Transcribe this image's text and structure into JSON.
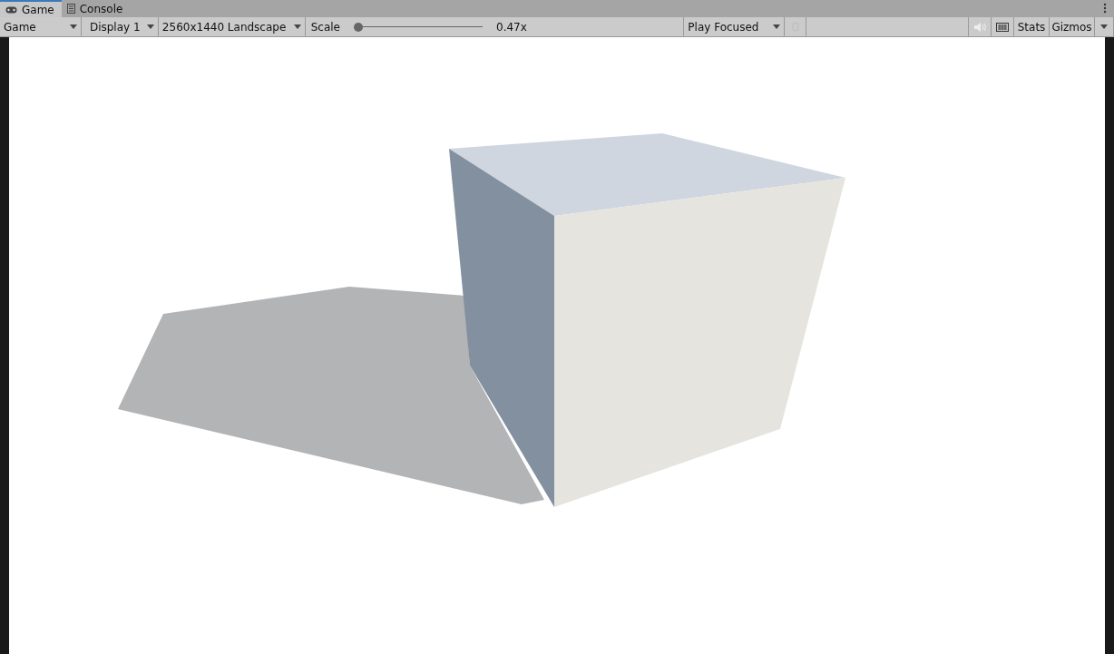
{
  "tabs": [
    {
      "label": "Game",
      "kind": "game",
      "selected": true
    },
    {
      "label": "Console",
      "kind": "console",
      "selected": false
    }
  ],
  "toolbar": {
    "view_mode": "Game",
    "display": "Display 1",
    "resolution": "2560x1440 Landscape",
    "scale": {
      "label": "Scale",
      "level": 0.02,
      "reading": "0.47x"
    },
    "play_mode": "Play Focused",
    "mute_audio": false,
    "stats": "Stats",
    "gizmos": "Gizmos"
  }
}
